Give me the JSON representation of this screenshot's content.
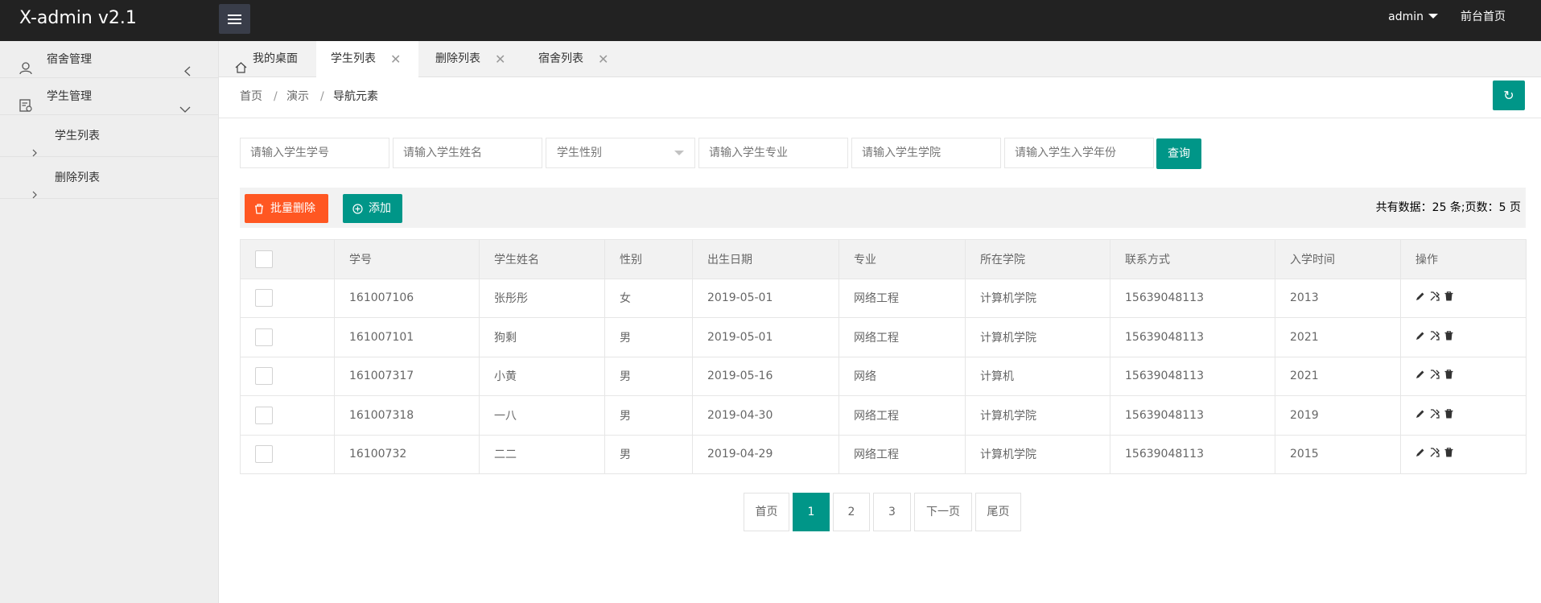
{
  "header": {
    "logo": "X-admin v2.1",
    "user": "admin",
    "front_link": "前台首页"
  },
  "sidebar": {
    "items": [
      {
        "label": "宿舍管理",
        "icon": "user-icon"
      },
      {
        "label": "学生管理",
        "icon": "student-card-icon"
      }
    ],
    "subitems": [
      {
        "label": "学生列表"
      },
      {
        "label": "删除列表"
      }
    ]
  },
  "tabs": [
    {
      "label": "我的桌面"
    },
    {
      "label": "学生列表"
    },
    {
      "label": "删除列表"
    },
    {
      "label": "宿舍列表"
    }
  ],
  "tab_close": "✕",
  "breadcrumb": {
    "items": [
      "首页",
      "演示",
      "导航元素"
    ],
    "separator": "/"
  },
  "refresh": {
    "icon": "refresh-icon",
    "label": "↻"
  },
  "search": {
    "placeholders": [
      "请输入学生学号",
      "请输入学生姓名",
      "请输入学生专业",
      "请输入学生学院",
      "请输入学生入学年份"
    ],
    "gender_select": "学生性别",
    "query_label": "查询"
  },
  "toolbar": {
    "batch_delete_label": "批量删除",
    "add_label": "添加",
    "total_text": "共有数据：25 条;页数：5 页"
  },
  "table": {
    "headers": [
      "学号",
      "学生姓名",
      "性别",
      "出生日期",
      "专业",
      "所在学院",
      "联系方式",
      "入学时间",
      "操作"
    ],
    "rows": [
      [
        "161007106",
        "张彤彤",
        "女",
        "2019-05-01",
        "网络工程",
        "计算机学院",
        "15639048113",
        "2013"
      ],
      [
        "161007101",
        "狗剩",
        "男",
        "2019-05-01",
        "网络工程",
        "计算机学院",
        "15639048113",
        "2021"
      ],
      [
        "161007317",
        "小黄",
        "男",
        "2019-05-16",
        "网络",
        "计算机",
        "15639048113",
        "2021"
      ],
      [
        "161007318",
        "一八",
        "男",
        "2019-04-30",
        "网络工程",
        "计算机学院",
        "15639048113",
        "2019"
      ],
      [
        "16100732",
        "二二",
        "男",
        "2019-04-29",
        "网络工程",
        "计算机学院",
        "15639048113",
        "2015"
      ]
    ]
  },
  "pagination": {
    "first": "首页",
    "pages": [
      "1",
      "2",
      "3"
    ],
    "current": "1",
    "next": "下一页",
    "last": "尾页"
  },
  "colors": {
    "header_bg": "#222222",
    "sidebar_bg": "#eeeeee",
    "accent": "#009688",
    "danger": "#ff5722"
  }
}
